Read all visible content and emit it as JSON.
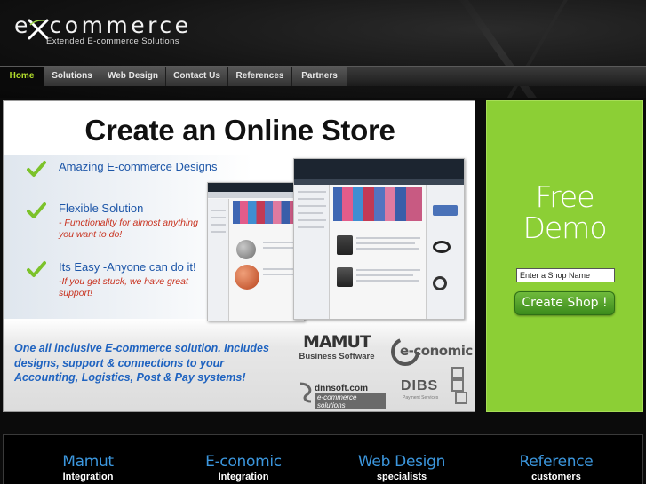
{
  "header": {
    "logo_text": "eXcommerce",
    "logo_tagline": "Extended  E-commerce  Solutions"
  },
  "nav": {
    "items": [
      {
        "label": "Home",
        "active": true
      },
      {
        "label": "Solutions",
        "active": false
      },
      {
        "label": "Web Design",
        "active": false
      },
      {
        "label": "Contact Us",
        "active": false
      },
      {
        "label": "References",
        "active": false
      },
      {
        "label": "Partners",
        "active": false
      }
    ]
  },
  "promo": {
    "title": "Create an Online Store",
    "features": [
      {
        "title": "Amazing E-commerce Designs",
        "subtitle": ""
      },
      {
        "title": "Flexible Solution",
        "subtitle": "- Functionality for almost anything you want to do!"
      },
      {
        "title": "Its Easy -Anyone can do it!",
        "subtitle": "-If you get stuck, we have great support!"
      }
    ],
    "tagline": "One all inclusive E-commerce solution. Includes designs, support & connections to your Accounting, Logistics, Post & Pay systems!",
    "partners": {
      "mamut": {
        "name": "MAMUT",
        "sub": "Business Software"
      },
      "economic": {
        "name": "e-conomic"
      },
      "dnn": {
        "name": "dnnsoft.com",
        "sub": "e-commerce solutions"
      },
      "dibs": {
        "name": "DIBS",
        "sub": "Payment Services"
      }
    }
  },
  "demo": {
    "title_line1": "Free",
    "title_line2": "Demo",
    "input_value": "Enter a Shop Name",
    "button_label": "Create Shop !"
  },
  "services": [
    {
      "title": "Mamut",
      "sub": "Integration"
    },
    {
      "title": "E-conomic",
      "sub": "Integration"
    },
    {
      "title": "Web Design",
      "sub": "specialists"
    },
    {
      "title": "Reference",
      "sub": "customers"
    }
  ],
  "colors": {
    "accent_green": "#8ccf35",
    "link_blue": "#1d56a8",
    "service_blue": "#3c97de",
    "active_nav": "#b5e02c"
  }
}
